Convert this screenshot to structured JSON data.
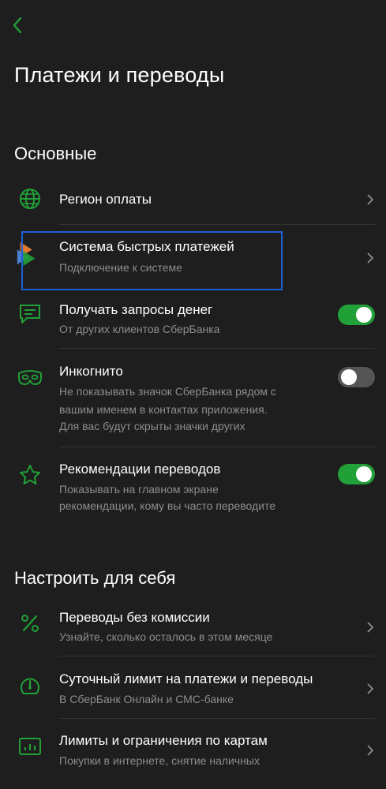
{
  "header": {
    "title": "Платежи и переводы"
  },
  "sections": {
    "main_title": "Основные",
    "custom_title": "Настроить для себя"
  },
  "rows": {
    "region": {
      "title": "Регион оплаты",
      "icon": "globe-icon"
    },
    "sbp": {
      "title": "Система быстрых платежей",
      "sub": "Подключение к системе",
      "icon": "sbp-logo-icon"
    },
    "requests": {
      "title": "Получать запросы денег",
      "sub": "От других клиентов СберБанка",
      "icon": "message-icon",
      "toggle_on": true
    },
    "incognito": {
      "title": "Инкогнито",
      "sub1": "Не показывать значок СберБанка рядом с",
      "sub2": "вашим именем в контактах приложения.",
      "sub3": "Для вас будут скрыты значки других",
      "icon": "mask-icon",
      "toggle_on": false
    },
    "recommendations": {
      "title": "Рекомендации переводов",
      "sub1": "Показывать на главном экране",
      "sub2": "рекомендации, кому вы часто переводите",
      "icon": "star-icon",
      "toggle_on": true
    },
    "no_fee": {
      "title": "Переводы без комиссии",
      "sub": "Узнайте, сколько осталось в этом месяце",
      "icon": "percent-icon"
    },
    "daily_limit": {
      "title": "Суточный лимит на платежи и переводы",
      "sub": "В СберБанк Онлайн и СМС-банке",
      "icon": "speedometer-icon"
    },
    "card_limits": {
      "title": "Лимиты и ограничения по картам",
      "sub": "Покупки в интернете, снятие наличных",
      "icon": "chart-icon"
    }
  },
  "colors": {
    "accent": "#21a038",
    "background": "#1e1e1e",
    "subtext": "#8d8d8d",
    "highlight": "#1f5fd6"
  }
}
